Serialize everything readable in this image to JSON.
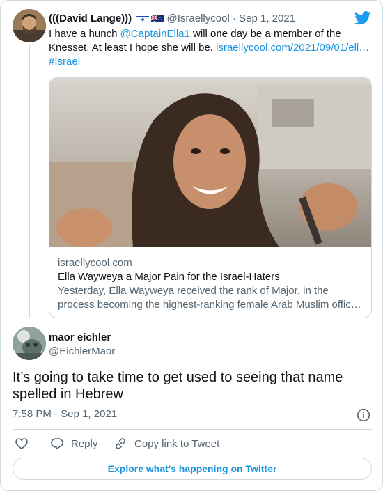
{
  "parent": {
    "author_name": "(((David Lange)))",
    "handle": "@Israellycool",
    "separator": "·",
    "date": "Sep 1, 2021",
    "text_before": "I have a hunch ",
    "mention": "@CaptainElla1",
    "text_after": " will one day be a member of the Knesset. At least I hope she will be. ",
    "url": "israellycool.com/2021/09/01/ell…",
    "hashtag": "#Israel"
  },
  "link_card": {
    "domain": "israellycool.com",
    "title": "Ella Wayweya a Major Pain for the Israel-Haters",
    "description_line1": "Yesterday, Ella Wayweya received the rank of Major, in the",
    "description_line2": "process becoming the highest-ranking female Arab Muslim offic…"
  },
  "tweet": {
    "author_name": "maor eichler",
    "handle": "@EichlerMaor",
    "text": "It’s going to take time to get used to seeing that name spelled in Hebrew",
    "time": "7:58 PM",
    "separator": "·",
    "date": "Sep 1, 2021"
  },
  "actions": {
    "reply_label": "Reply",
    "copy_label": "Copy link to Tweet"
  },
  "explore_label": "Explore what's happening on Twitter",
  "icons": [
    "twitter-bird-icon",
    "info-icon",
    "heart-icon",
    "reply-icon",
    "link-icon",
    "israel-flag-icon",
    "australia-flag-icon"
  ],
  "colors": {
    "link": "#1b95e0",
    "text": "#0f1419",
    "secondary": "#536471",
    "border": "#cfd9de",
    "twitter_blue": "#1d9bf0"
  }
}
